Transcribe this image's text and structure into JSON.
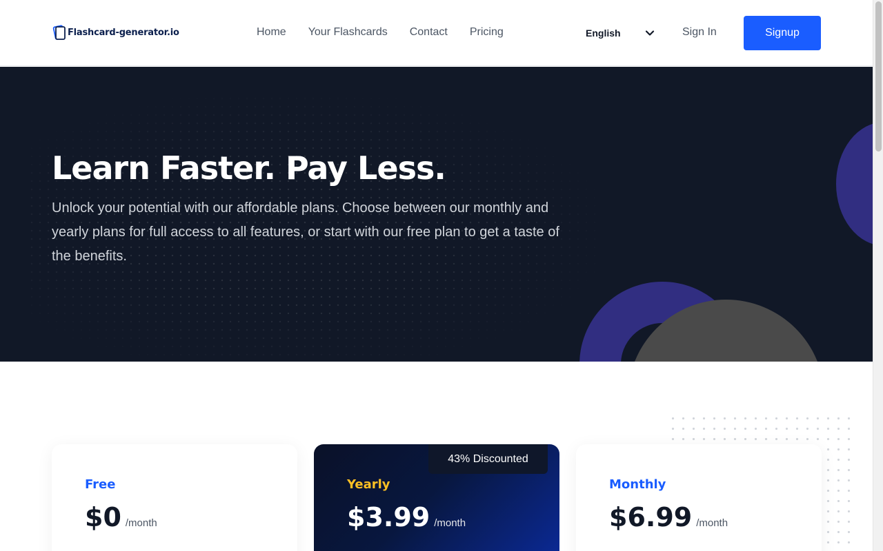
{
  "header": {
    "logo_text": "Flashcard-generator.io",
    "nav": [
      "Home",
      "Your Flashcards",
      "Contact",
      "Pricing"
    ],
    "language": "English",
    "sign_in": "Sign In",
    "signup": "Signup"
  },
  "hero": {
    "title": "Learn Faster. Pay Less.",
    "subtitle": "Unlock your potential with our affordable plans. Choose between our monthly and yearly plans for full access to all features, or start with our free plan to get a taste of the benefits."
  },
  "plans": [
    {
      "name": "Free",
      "price": "$0",
      "period": "/month"
    },
    {
      "name": "Yearly",
      "price": "$3.99",
      "period": "/month",
      "badge": "43% Discounted"
    },
    {
      "name": "Monthly",
      "price": "$6.99",
      "period": "/month"
    }
  ],
  "colors": {
    "accent": "#1a5dff",
    "hero_bg": "#111827",
    "yearly_label": "#fbbf24"
  }
}
